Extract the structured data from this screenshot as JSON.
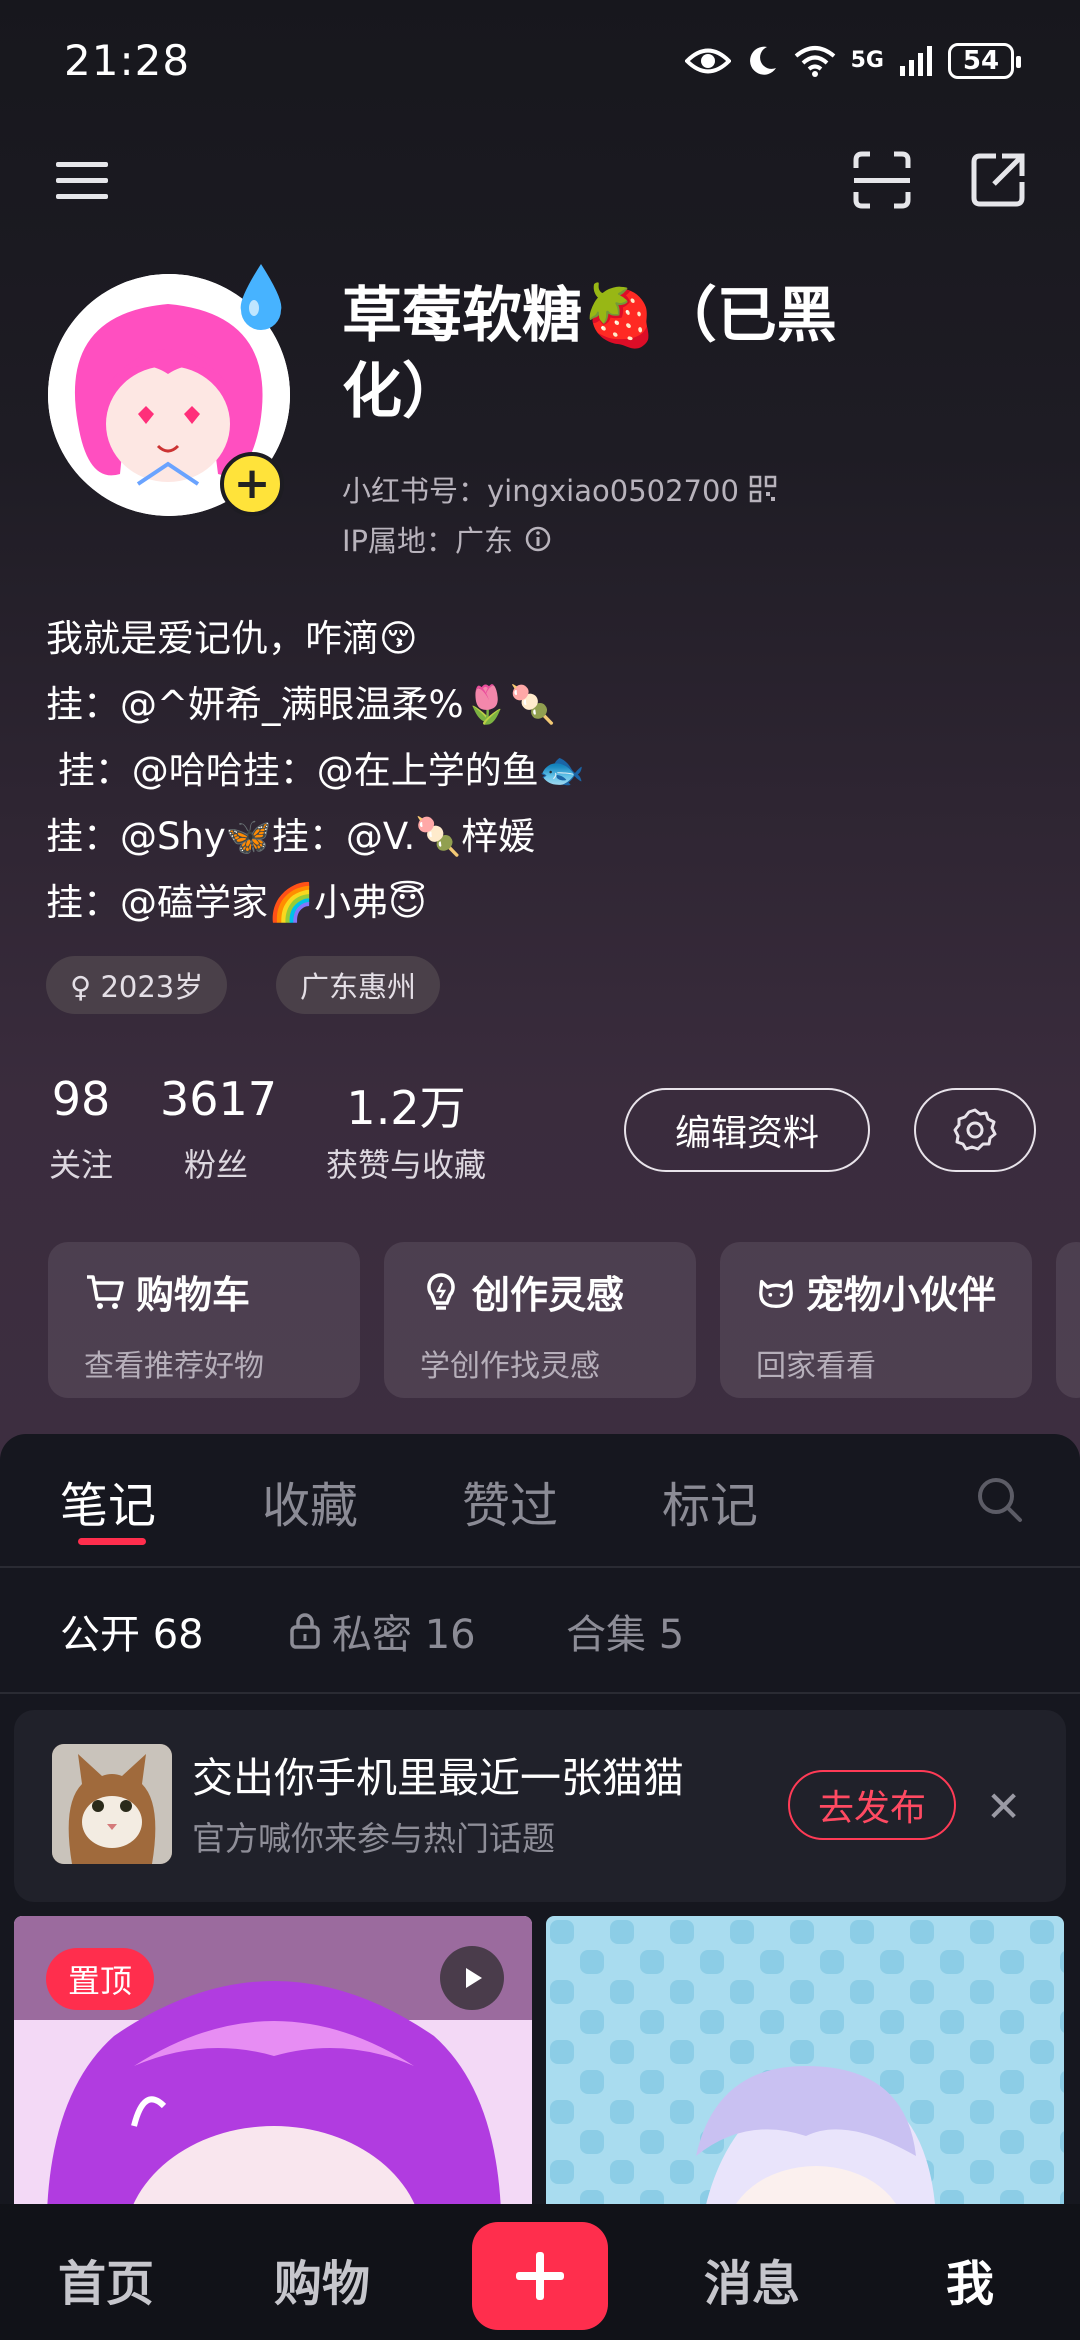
{
  "status_bar": {
    "time": "21:28",
    "network": "5G",
    "battery": "54"
  },
  "profile": {
    "name": "草莓软糖🍓（已黑化）",
    "id_line": "小红书号：yingxiao0502700",
    "ip_line": "IP属地：广东",
    "bio": "我就是爱记仇，咋滴😚\n挂：@^妍希_满眼温柔%🌷🍡\n 挂：@哈哈挂：@在上学的鱼🐟\n挂：@Shy🦋挂：@V.🍡梓媛\n挂：@磕学家🌈小弗😇",
    "tags": [
      "♀ 2023岁",
      "广东惠州"
    ],
    "stats": [
      {
        "num": "98",
        "label": "关注"
      },
      {
        "num": "3617",
        "label": "粉丝"
      },
      {
        "num": "1.2万",
        "label": "获赞与收藏"
      }
    ],
    "edit_label": "编辑资料"
  },
  "cards": [
    {
      "title": "购物车",
      "sub": "查看推荐好物",
      "icon": "cart-icon"
    },
    {
      "title": "创作灵感",
      "sub": "学创作找灵感",
      "icon": "bulb-icon"
    },
    {
      "title": "宠物小伙伴",
      "sub": "回家看看",
      "icon": "pet-icon"
    }
  ],
  "tabs": [
    "笔记",
    "收藏",
    "赞过",
    "标记"
  ],
  "sub_tabs": [
    "公开 68",
    "私密 16",
    "合集 5"
  ],
  "banner": {
    "title": "交出你手机里最近一张猫猫",
    "sub": "官方喊你来参与热门话题",
    "button": "去发布",
    "close": "✕"
  },
  "posts": [
    {
      "badge": "置顶"
    }
  ],
  "nav": [
    "首页",
    "购物",
    "消息",
    "我"
  ],
  "colors": {
    "accent": "#ff2e4d",
    "background": "#171821"
  }
}
